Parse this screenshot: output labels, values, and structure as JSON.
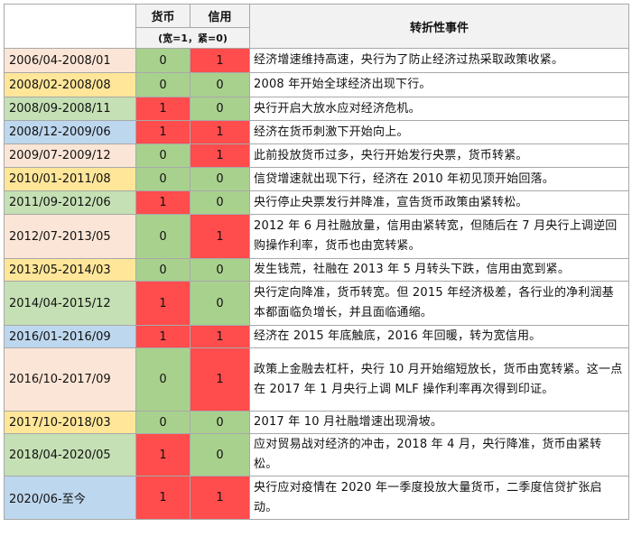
{
  "header": {
    "currency": "货币",
    "credit": "信用",
    "legend": "(宽=1，紧=0)",
    "events": "转折性事件"
  },
  "colors": {
    "zero": "#a9d18e",
    "one": "#ff4d4d",
    "peach": "#fbe5d6",
    "yellow": "#ffe699",
    "green": "#c5e0b4",
    "blue": "#bdd7ee"
  },
  "rows": [
    {
      "period": "2006/04-2008/01",
      "currency": "0",
      "credit": "1",
      "event": "经济增速维持高速，央行为了防止经济过热采取政策收紧。"
    },
    {
      "period": "2008/02-2008/08",
      "currency": "0",
      "credit": "0",
      "event": "2008 年开始全球经济出现下行。"
    },
    {
      "period": "2008/09-2008/11",
      "currency": "1",
      "credit": "0",
      "event": "央行开启大放水应对经济危机。"
    },
    {
      "period": "2008/12-2009/06",
      "currency": "1",
      "credit": "1",
      "event": "经济在货币刺激下开始向上。"
    },
    {
      "period": "2009/07-2009/12",
      "currency": "0",
      "credit": "1",
      "event": "此前投放货币过多，央行开始发行央票，货币转紧。"
    },
    {
      "period": "2010/01-2011/08",
      "currency": "0",
      "credit": "0",
      "event": "信贷增速就出现下行，经济在 2010 年初见顶开始回落。"
    },
    {
      "period": "2011/09-2012/06",
      "currency": "1",
      "credit": "0",
      "event": "央行停止央票发行并降准，宣告货币政策由紧转松。"
    },
    {
      "period": "2012/07-2013/05",
      "currency": "0",
      "credit": "1",
      "event": "2012 年 6 月社融放量，信用由紧转宽，但随后在 7 月央行上调逆回购操作利率，货币也由宽转紧。"
    },
    {
      "period": "2013/05-2014/03",
      "currency": "0",
      "credit": "0",
      "event": "发生钱荒，社融在 2013 年 5 月转头下跌，信用由宽到紧。"
    },
    {
      "period": "2014/04-2015/12",
      "currency": "1",
      "credit": "0",
      "event": "央行定向降准，货币转宽。但 2015 年经济极差，各行业的净利润基本都面临负增长，并且面临通缩。"
    },
    {
      "period": "2016/01-2016/09",
      "currency": "1",
      "credit": "1",
      "event": "经济在 2015 年底触底，2016 年回暖，转为宽信用。"
    },
    {
      "period": "2016/10-2017/09",
      "currency": "0",
      "credit": "1",
      "event": "政策上金融去杠杆，央行 10 月开始缩短放长，货币由宽转紧。这一点在 2017 年 1 月央行上调 MLF 操作利率再次得到印证。"
    },
    {
      "period": "2017/10-2018/03",
      "currency": "0",
      "credit": "0",
      "event": "2017 年 10 月社融增速出现滑坡。"
    },
    {
      "period": "2018/04-2020/05",
      "currency": "1",
      "credit": "0",
      "event": "应对贸易战对经济的冲击，2018 年 4 月，央行降准，货币由紧转松。"
    },
    {
      "period": "2020/06-至今",
      "currency": "1",
      "credit": "1",
      "event": "央行应对疫情在 2020 年一季度投放大量货币，二季度信贷扩张启动。"
    }
  ]
}
